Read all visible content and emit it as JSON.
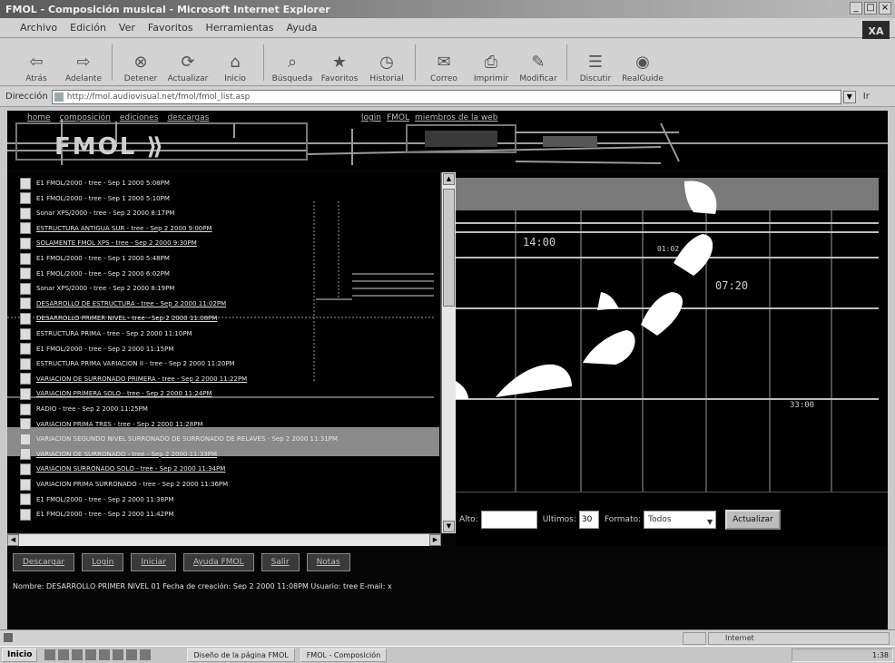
{
  "window": {
    "title": "FMOL - Composición musical - Microsoft Internet Explorer"
  },
  "menu": [
    "Archivo",
    "Edición",
    "Ver",
    "Favoritos",
    "Herramientas",
    "Ayuda"
  ],
  "brand": "XA",
  "toolbar": [
    {
      "label": "Atrás",
      "icon": "back-arrow-icon",
      "glyph": "⇦"
    },
    {
      "label": "Adelante",
      "icon": "forward-arrow-icon",
      "glyph": "⇨"
    },
    {
      "label": "Detener",
      "icon": "stop-icon",
      "glyph": "⊗"
    },
    {
      "label": "Actualizar",
      "icon": "refresh-icon",
      "glyph": "⟳"
    },
    {
      "label": "Inicio",
      "icon": "home-icon",
      "glyph": "⌂"
    },
    {
      "label": "Búsqueda",
      "icon": "search-icon",
      "glyph": "⌕"
    },
    {
      "label": "Favoritos",
      "icon": "favorites-icon",
      "glyph": "★"
    },
    {
      "label": "Historial",
      "icon": "history-icon",
      "glyph": "◷"
    },
    {
      "label": "Correo",
      "icon": "mail-icon",
      "glyph": "✉"
    },
    {
      "label": "Imprimir",
      "icon": "print-icon",
      "glyph": "⎙"
    },
    {
      "label": "Modificar",
      "icon": "edit-icon",
      "glyph": "✎"
    },
    {
      "label": "Discutir",
      "icon": "discuss-icon",
      "glyph": "☰"
    },
    {
      "label": "RealGuide",
      "icon": "realguide-icon",
      "glyph": "◉"
    }
  ],
  "address": {
    "label": "Dirección",
    "value": "http://fmol.audiovisual.net/fmol/fmol_list.asp",
    "go": "Ir"
  },
  "banner": {
    "logo": "FMOL  ⟫",
    "nav_left": [
      "home",
      "composición",
      "ediciones",
      "descargas"
    ],
    "nav_right": [
      "login",
      "FMOL",
      "miembros de la web"
    ]
  },
  "list": [
    {
      "text": "E1 FMOL/2000 - tree - Sep 1 2000 5:08PM",
      "u": false
    },
    {
      "text": "E1 FMOL/2000 - tree - Sep 1 2000 5:10PM",
      "u": false
    },
    {
      "text": "Sonar XPS/2000 - tree - Sep 2 2000 8:17PM",
      "u": false
    },
    {
      "text": "ESTRUCTURA ANTIGUA SUR - tree - Sep 2 2000 9:00PM",
      "u": true
    },
    {
      "text": "SOLAMENTE FMOL XPS - tree - Sep 2 2000 9:30PM",
      "u": true
    },
    {
      "text": "E1 FMOL/2000 - tree - Sep 1 2000 5:48PM",
      "u": false
    },
    {
      "text": "E1 FMOL/2000 - tree - Sep 2 2000 6:02PM",
      "u": false
    },
    {
      "text": "Sonar XPS/2000 - tree - Sep 2 2000 8:19PM",
      "u": false
    },
    {
      "text": "DESARROLLO DE ESTRUCTURA - tree - Sep 2 2000 11:02PM",
      "u": true
    },
    {
      "text": "DESARROLLO PRIMER NIVEL - tree - Sep 2 2000 11:08PM",
      "u": true
    },
    {
      "text": "ESTRUCTURA PRIMA - tree - Sep 2 2000 11:10PM",
      "u": false
    },
    {
      "text": "E1 FMOL/2000 - tree - Sep 2 2000 11:15PM",
      "u": false
    },
    {
      "text": "ESTRUCTURA PRIMA VARIACION II - tree - Sep 2 2000 11:20PM",
      "u": false
    },
    {
      "text": "VARIACION DE SURRONADO PRIMERA - tree - Sep 2 2000 11:22PM",
      "u": true
    },
    {
      "text": "VARIACION PRIMERA SOLO - tree - Sep 2 2000 11:24PM",
      "u": true
    },
    {
      "text": "RADIO - tree - Sep 2 2000 11:25PM",
      "u": false
    },
    {
      "text": "VARIACION PRIMA TRES - tree - Sep 2 2000 11:28PM",
      "u": false
    },
    {
      "text": "VARIACION SEGUNDO NIVEL SURRONADO DE SURRONADO DE RELAVES - Sep 2 2000 11:31PM",
      "u": false
    },
    {
      "text": "VARIACION DE SURRONADO - tree - Sep 2 2000 11:33PM",
      "u": true
    },
    {
      "text": "VARIACION SURRONADO SOLO - tree - Sep 2 2000 11:34PM",
      "u": true
    },
    {
      "text": "VARIACION PRIMA SURRONADO - tree - Sep 2 2000 11:36PM",
      "u": false
    },
    {
      "text": "E1 FMOL/2000 - tree - Sep 2 2000 11:38PM",
      "u": false
    },
    {
      "text": "E1 FMOL/2000 - tree - Sep 2 2000 11:42PM",
      "u": false
    }
  ],
  "chart_labels": {
    "t1": "14:00",
    "t2": "07:20",
    "t3": "33:00",
    "t4": "01:02"
  },
  "controls": {
    "alto_label": "Alto:",
    "alto_value": "",
    "ultimos_label": "Ultimos:",
    "ultimos_value": "30",
    "formato_label": "Formato:",
    "formato_value": "Todos",
    "submit": "Actualizar"
  },
  "navbuttons": [
    "Descargar",
    "Login",
    "Iniciar",
    "Ayuda FMOL",
    "Salir",
    "Notas"
  ],
  "status_text": "Nombre: DESARROLLO PRIMER NIVEL 01 Fecha de creación: Sep 2 2000 11:08PM Usuario: tree E-mail: x",
  "statusbar": {
    "zone": "Internet"
  },
  "taskbar": {
    "start": "Inicio",
    "tasks": [
      "Diseño de la página FMOL",
      "FMOL - Composición"
    ],
    "clock": "1:38"
  }
}
